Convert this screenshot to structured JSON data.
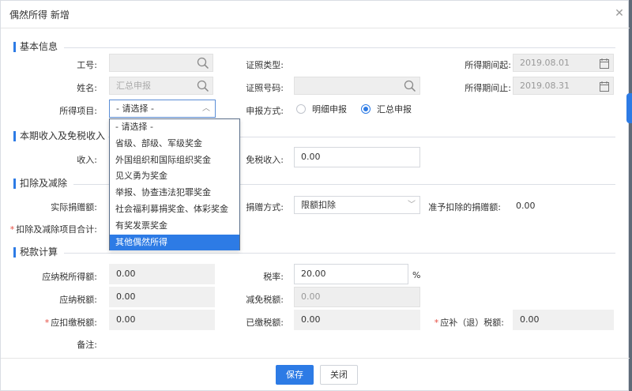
{
  "dialog": {
    "title": "偶然所得 新增",
    "close_icon": "close-icon"
  },
  "sections": {
    "basic": "基本信息",
    "income": "本期收入及免税收入",
    "deduction": "扣除及减除",
    "tax": "税款计算"
  },
  "basic": {
    "employee_no_label": "工号:",
    "employee_no_value": "",
    "name_label": "姓名:",
    "name_placeholder": "汇总申报",
    "income_item_label": "所得项目:",
    "income_item_value": "- 请选择 -",
    "id_type_label": "证照类型:",
    "id_no_label": "证照号码:",
    "id_no_value": "",
    "report_method_label": "申报方式:",
    "report_options": [
      "明细申报",
      "汇总申报"
    ],
    "report_selected": "汇总申报",
    "period_start_label": "所得期间起:",
    "period_start_value": "2019.08.01",
    "period_end_label": "所得期间止:",
    "period_end_value": "2019.08.31"
  },
  "income_item_options": [
    "- 请选择 -",
    "省级、部级、军级奖金",
    "外国组织和国际组织奖金",
    "见义勇为奖金",
    "举报、协查违法犯罪奖金",
    "社会福利募捐奖金、体彩奖金",
    "有奖发票奖金",
    "其他偶然所得"
  ],
  "income_item_highlighted": "其他偶然所得",
  "income": {
    "income_label": "收入:",
    "tax_free_label": "免税收入:",
    "tax_free_value": "0.00"
  },
  "deduction": {
    "actual_donation_label": "实际捐赠额:",
    "donation_method_label": "捐赠方式:",
    "donation_method_value": "限额扣除",
    "allowed_donation_label": "准予扣除的捐赠额:",
    "allowed_donation_value": "0.00",
    "total_label": "扣除及减除项目合计:"
  },
  "tax": {
    "taxable_income_label": "应纳税所得额:",
    "taxable_income_value": "0.00",
    "rate_label": "税率:",
    "rate_value": "20.00",
    "rate_unit": "%",
    "tax_payable_label": "应纳税额:",
    "tax_payable_value": "0.00",
    "tax_relief_label": "减免税额:",
    "tax_relief_value": "0.00",
    "withholding_label": "应扣缴税额:",
    "withholding_value": "0.00",
    "paid_label": "已缴税额:",
    "paid_value": "0.00",
    "refund_label": "应补（退）税额:",
    "refund_value": "0.00",
    "remark_label": "备注:"
  },
  "buttons": {
    "save": "保存",
    "close": "关闭"
  },
  "colors": {
    "accent": "#2d7be5",
    "required": "#e54d42",
    "disabled_bg": "#eeeeee"
  }
}
